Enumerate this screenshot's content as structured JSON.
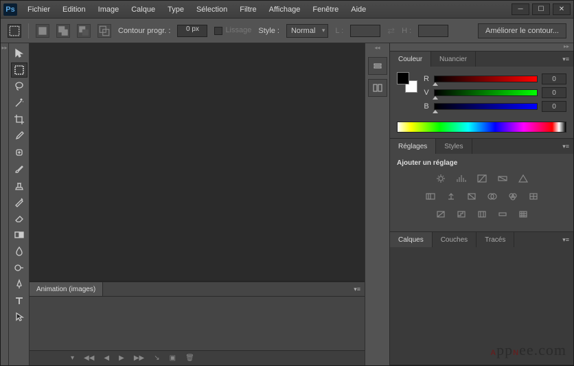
{
  "menu": [
    "Fichier",
    "Edition",
    "Image",
    "Calque",
    "Type",
    "Sélection",
    "Filtre",
    "Affichage",
    "Fenêtre",
    "Aide"
  ],
  "options": {
    "contour_label": "Contour progr. :",
    "contour_value": "0 px",
    "lissage": "Lissage",
    "style_label": "Style :",
    "style_value": "Normal",
    "l_label": "L :",
    "h_label": "H :",
    "refine": "Améliorer le contour..."
  },
  "animation": {
    "tab": "Animation (images)"
  },
  "color": {
    "tab1": "Couleur",
    "tab2": "Nuancier",
    "r_label": "R",
    "r_val": "0",
    "v_label": "V",
    "v_val": "0",
    "b_label": "B",
    "b_val": "0",
    "fg": "#000000",
    "bg": "#ffffff"
  },
  "reglages": {
    "tab1": "Réglages",
    "tab2": "Styles",
    "add": "Ajouter un réglage"
  },
  "layers": {
    "tab1": "Calques",
    "tab2": "Couches",
    "tab3": "Tracés"
  },
  "watermark": "AppNee.com"
}
